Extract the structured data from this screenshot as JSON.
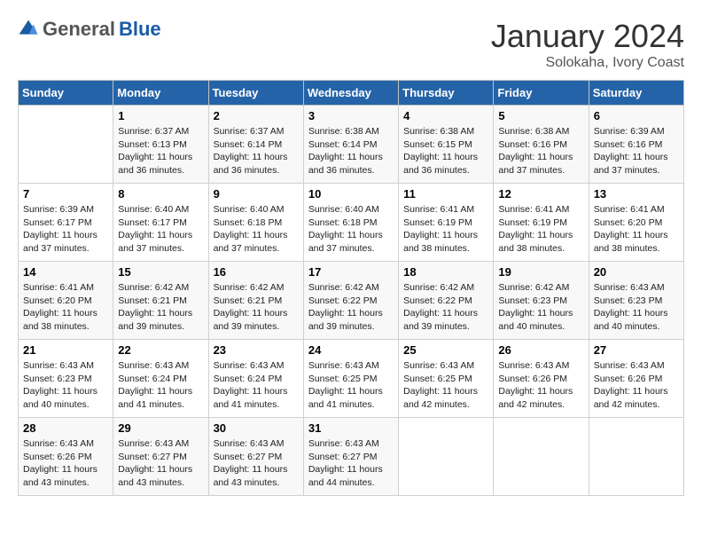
{
  "header": {
    "logo_general": "General",
    "logo_blue": "Blue",
    "month_title": "January 2024",
    "subtitle": "Solokaha, Ivory Coast"
  },
  "days_of_week": [
    "Sunday",
    "Monday",
    "Tuesday",
    "Wednesday",
    "Thursday",
    "Friday",
    "Saturday"
  ],
  "weeks": [
    [
      {
        "day": "",
        "content": ""
      },
      {
        "day": "1",
        "content": "Sunrise: 6:37 AM\nSunset: 6:13 PM\nDaylight: 11 hours and 36 minutes."
      },
      {
        "day": "2",
        "content": "Sunrise: 6:37 AM\nSunset: 6:14 PM\nDaylight: 11 hours and 36 minutes."
      },
      {
        "day": "3",
        "content": "Sunrise: 6:38 AM\nSunset: 6:14 PM\nDaylight: 11 hours and 36 minutes."
      },
      {
        "day": "4",
        "content": "Sunrise: 6:38 AM\nSunset: 6:15 PM\nDaylight: 11 hours and 36 minutes."
      },
      {
        "day": "5",
        "content": "Sunrise: 6:38 AM\nSunset: 6:16 PM\nDaylight: 11 hours and 37 minutes."
      },
      {
        "day": "6",
        "content": "Sunrise: 6:39 AM\nSunset: 6:16 PM\nDaylight: 11 hours and 37 minutes."
      }
    ],
    [
      {
        "day": "7",
        "content": "Sunrise: 6:39 AM\nSunset: 6:17 PM\nDaylight: 11 hours and 37 minutes."
      },
      {
        "day": "8",
        "content": "Sunrise: 6:40 AM\nSunset: 6:17 PM\nDaylight: 11 hours and 37 minutes."
      },
      {
        "day": "9",
        "content": "Sunrise: 6:40 AM\nSunset: 6:18 PM\nDaylight: 11 hours and 37 minutes."
      },
      {
        "day": "10",
        "content": "Sunrise: 6:40 AM\nSunset: 6:18 PM\nDaylight: 11 hours and 37 minutes."
      },
      {
        "day": "11",
        "content": "Sunrise: 6:41 AM\nSunset: 6:19 PM\nDaylight: 11 hours and 38 minutes."
      },
      {
        "day": "12",
        "content": "Sunrise: 6:41 AM\nSunset: 6:19 PM\nDaylight: 11 hours and 38 minutes."
      },
      {
        "day": "13",
        "content": "Sunrise: 6:41 AM\nSunset: 6:20 PM\nDaylight: 11 hours and 38 minutes."
      }
    ],
    [
      {
        "day": "14",
        "content": "Sunrise: 6:41 AM\nSunset: 6:20 PM\nDaylight: 11 hours and 38 minutes."
      },
      {
        "day": "15",
        "content": "Sunrise: 6:42 AM\nSunset: 6:21 PM\nDaylight: 11 hours and 39 minutes."
      },
      {
        "day": "16",
        "content": "Sunrise: 6:42 AM\nSunset: 6:21 PM\nDaylight: 11 hours and 39 minutes."
      },
      {
        "day": "17",
        "content": "Sunrise: 6:42 AM\nSunset: 6:22 PM\nDaylight: 11 hours and 39 minutes."
      },
      {
        "day": "18",
        "content": "Sunrise: 6:42 AM\nSunset: 6:22 PM\nDaylight: 11 hours and 39 minutes."
      },
      {
        "day": "19",
        "content": "Sunrise: 6:42 AM\nSunset: 6:23 PM\nDaylight: 11 hours and 40 minutes."
      },
      {
        "day": "20",
        "content": "Sunrise: 6:43 AM\nSunset: 6:23 PM\nDaylight: 11 hours and 40 minutes."
      }
    ],
    [
      {
        "day": "21",
        "content": "Sunrise: 6:43 AM\nSunset: 6:23 PM\nDaylight: 11 hours and 40 minutes."
      },
      {
        "day": "22",
        "content": "Sunrise: 6:43 AM\nSunset: 6:24 PM\nDaylight: 11 hours and 41 minutes."
      },
      {
        "day": "23",
        "content": "Sunrise: 6:43 AM\nSunset: 6:24 PM\nDaylight: 11 hours and 41 minutes."
      },
      {
        "day": "24",
        "content": "Sunrise: 6:43 AM\nSunset: 6:25 PM\nDaylight: 11 hours and 41 minutes."
      },
      {
        "day": "25",
        "content": "Sunrise: 6:43 AM\nSunset: 6:25 PM\nDaylight: 11 hours and 42 minutes."
      },
      {
        "day": "26",
        "content": "Sunrise: 6:43 AM\nSunset: 6:26 PM\nDaylight: 11 hours and 42 minutes."
      },
      {
        "day": "27",
        "content": "Sunrise: 6:43 AM\nSunset: 6:26 PM\nDaylight: 11 hours and 42 minutes."
      }
    ],
    [
      {
        "day": "28",
        "content": "Sunrise: 6:43 AM\nSunset: 6:26 PM\nDaylight: 11 hours and 43 minutes."
      },
      {
        "day": "29",
        "content": "Sunrise: 6:43 AM\nSunset: 6:27 PM\nDaylight: 11 hours and 43 minutes."
      },
      {
        "day": "30",
        "content": "Sunrise: 6:43 AM\nSunset: 6:27 PM\nDaylight: 11 hours and 43 minutes."
      },
      {
        "day": "31",
        "content": "Sunrise: 6:43 AM\nSunset: 6:27 PM\nDaylight: 11 hours and 44 minutes."
      },
      {
        "day": "",
        "content": ""
      },
      {
        "day": "",
        "content": ""
      },
      {
        "day": "",
        "content": ""
      }
    ]
  ]
}
